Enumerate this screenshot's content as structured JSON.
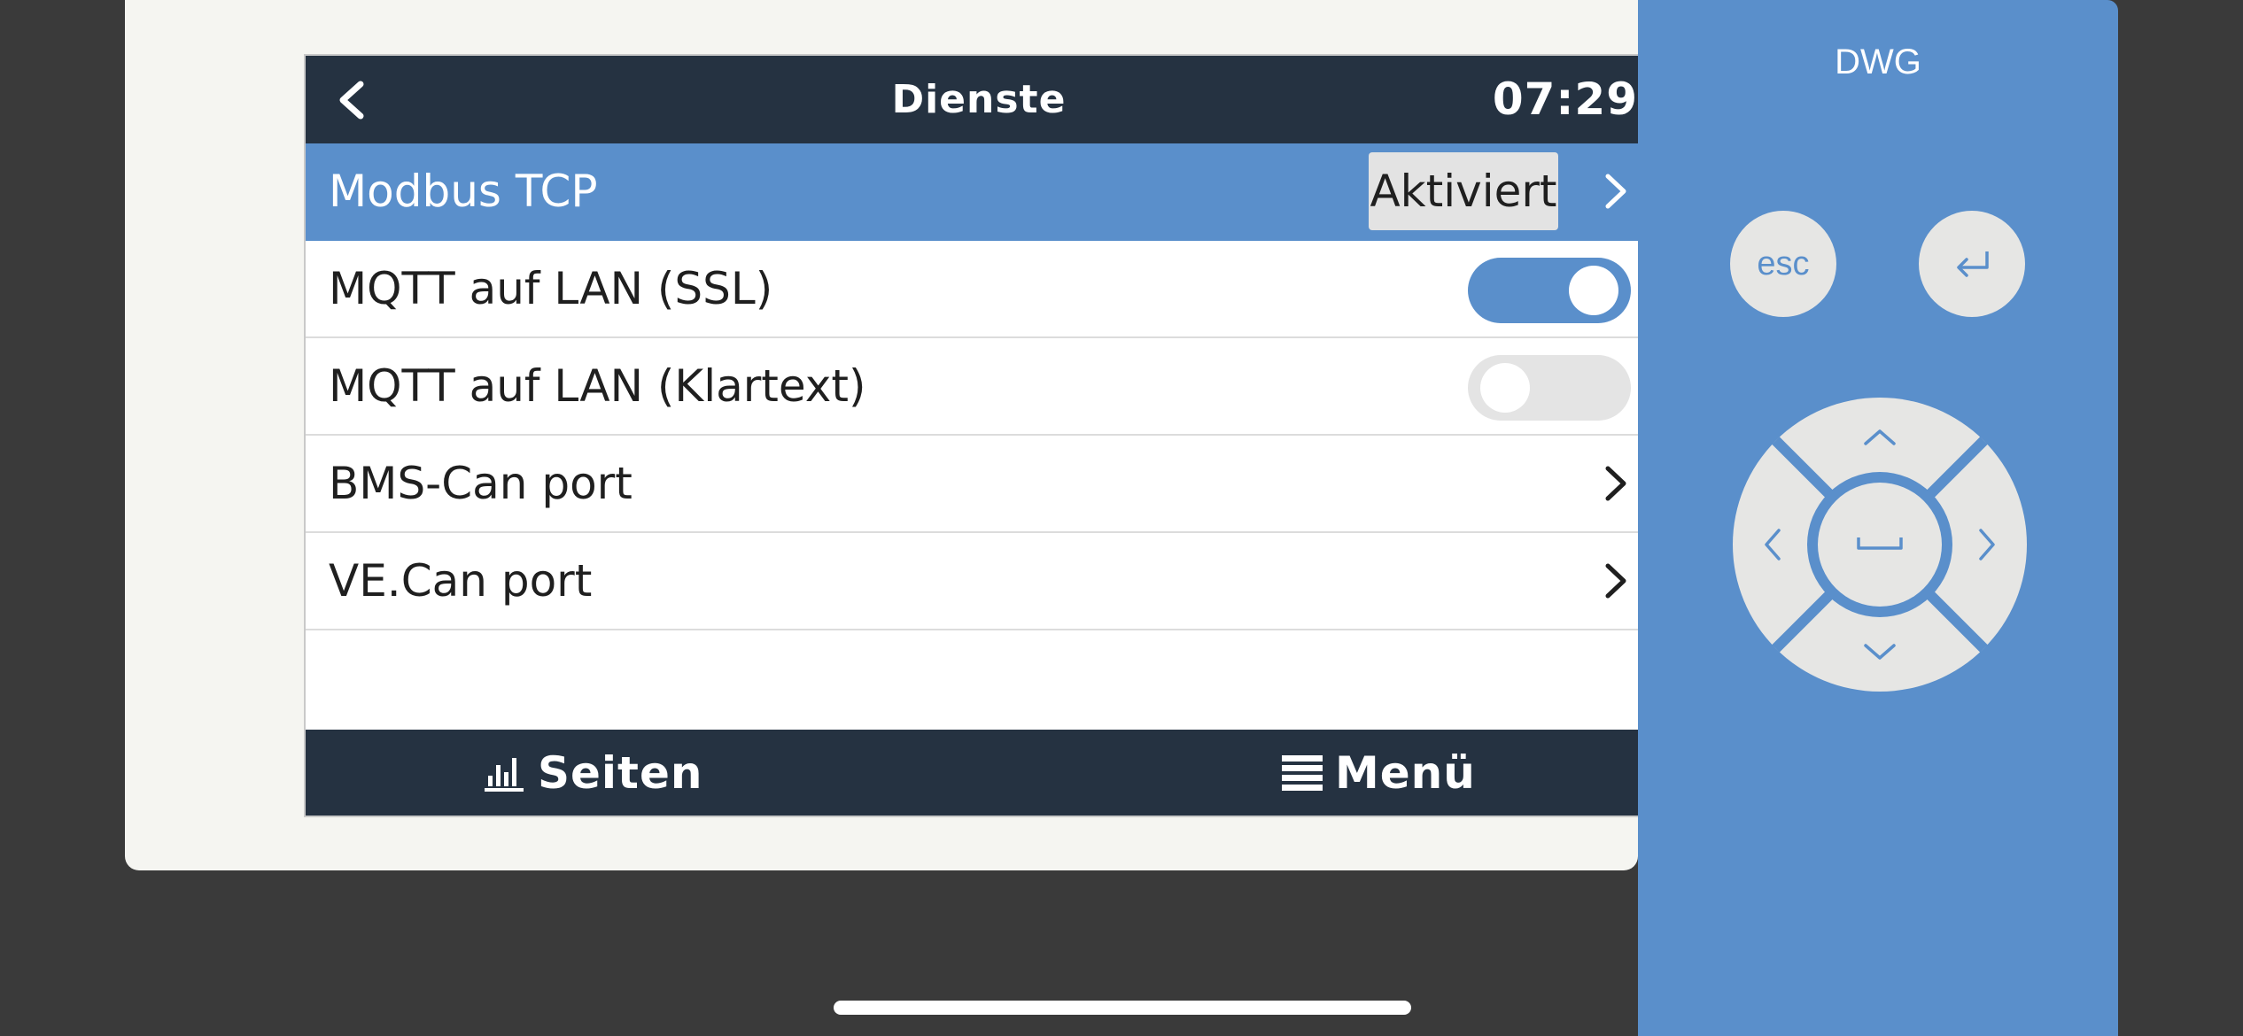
{
  "header": {
    "back_icon": "chevron-left-icon",
    "title": "Dienste",
    "time": "07:29"
  },
  "rows": [
    {
      "label": "Modbus TCP",
      "value": "Aktiviert",
      "type": "submenu",
      "selected": true
    },
    {
      "label": "MQTT auf LAN (SSL)",
      "type": "toggle",
      "checked": true
    },
    {
      "label": "MQTT auf LAN (Klartext)",
      "type": "toggle",
      "checked": false
    },
    {
      "label": "BMS-Can port",
      "type": "submenu"
    },
    {
      "label": "VE.Can port",
      "type": "submenu"
    }
  ],
  "footer": {
    "pages_label": "Seiten",
    "pages_icon": "bar-chart-icon",
    "menu_label": "Menü",
    "menu_icon": "hamburger-menu-icon"
  },
  "side_panel": {
    "device_name": "DWG",
    "esc_label": "esc",
    "enter_icon": "enter-return-icon",
    "dpad_icons": [
      "arrow-up-icon",
      "arrow-left-icon",
      "space-icon",
      "arrow-right-icon",
      "arrow-down-icon"
    ]
  },
  "colors": {
    "accent": "#5a8fcb",
    "header_bg": "#253241",
    "toggle_off": "#e4e4e4",
    "app_bg": "#3a3a3a"
  }
}
